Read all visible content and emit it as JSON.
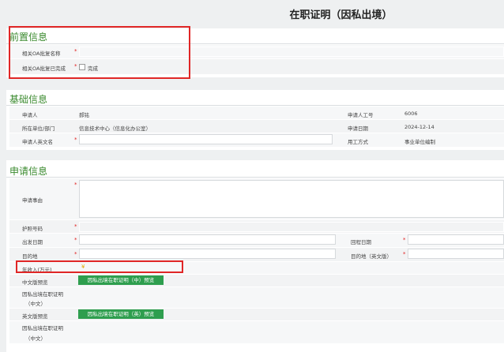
{
  "page": {
    "title": "在职证明（因私出境）"
  },
  "sections": {
    "pre": {
      "title": "前置信息",
      "oa_name_label": "相关OA批复名称",
      "oa_done_label": "相关OA批复已完成",
      "oa_done_check": "完成"
    },
    "basic": {
      "title": "基础信息",
      "applicant_label": "申请人",
      "applicant_value": "郝铭",
      "emp_no_label": "申请人工号",
      "emp_no_value": "6006",
      "dept_label": "所在单位/部门",
      "dept_value": "信息技术中心（信息化办公室）",
      "date_label": "申请日期",
      "date_value": "2024-12-14",
      "en_name_label": "申请人英文名",
      "emp_type_label": "用工方式",
      "emp_type_value": "事业单位编制"
    },
    "apply": {
      "title": "申请信息",
      "reason_label": "申请事由",
      "passport_label": "护照号码",
      "depart_label": "出发日期",
      "return_label": "回程日期",
      "dest_label": "目的地",
      "dest_en_label": "目的地（英文版）",
      "income_label": "年收入(万元)",
      "income_symbol": "¥",
      "cn_preview_label": "中文版预览",
      "cn_btn": "因私出境在职证明（中）预览",
      "cn_doc_label_1": "因私出境在职证明",
      "cn_doc_label_2": "（中文）",
      "en_preview_label": "英文版预览",
      "en_btn": "因私出境在职证明（英）预览",
      "en_doc_label_1": "因私出境在职证明",
      "en_doc_label_2": "（中文）"
    }
  },
  "colors": {
    "accent": "#3a8a2e",
    "button": "#2e9e4e",
    "highlight": "#e02626",
    "required": "#e02020"
  }
}
